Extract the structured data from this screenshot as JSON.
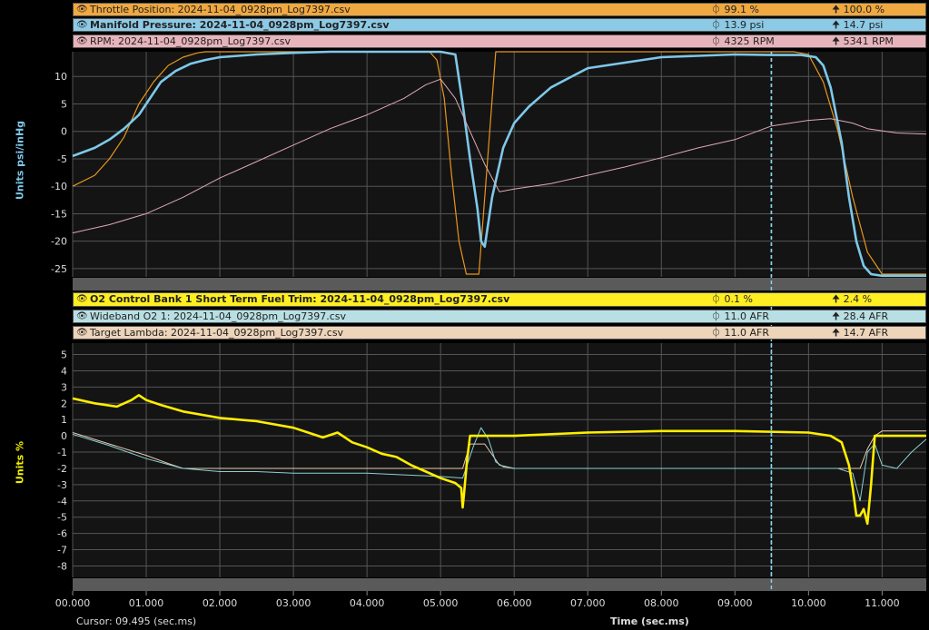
{
  "panels": [
    {
      "headers": [
        {
          "name": "Throttle Position: 2024-11-04_0928pm_Log7397.csv",
          "cursor": "99.1 %",
          "max": "100.0 %",
          "bg": "#f0a840",
          "bold": false
        },
        {
          "name": "Manifold Pressure: 2024-11-04_0928pm_Log7397.csv",
          "cursor": "13.9 psi",
          "max": "14.7 psi",
          "bg": "#8ccae6",
          "bold": true
        },
        {
          "name": "RPM: 2024-11-04_0928pm_Log7397.csv",
          "cursor": "4325 RPM",
          "max": "5341 RPM",
          "bg": "#e8b4bc",
          "bold": false
        }
      ],
      "axis_title": "Units psi/inHg",
      "axis_color": "#7ec8ea"
    },
    {
      "headers": [
        {
          "name": "O2 Control Bank 1 Short Term Fuel Trim: 2024-11-04_0928pm_Log7397.csv",
          "cursor": "0.1 %",
          "max": "2.4 %",
          "bg": "#ffee22",
          "bold": true
        },
        {
          "name": "Wideband O2 1: 2024-11-04_0928pm_Log7397.csv",
          "cursor": "11.0 AFR",
          "max": "28.4 AFR",
          "bg": "#b8e0e4",
          "bold": false
        },
        {
          "name": "Target Lambda: 2024-11-04_0928pm_Log7397.csv",
          "cursor": "11.0 AFR",
          "max": "14.7 AFR",
          "bg": "#eed4b8",
          "bold": false
        }
      ],
      "axis_title": "Units %",
      "axis_color": "#f0f000"
    }
  ],
  "cursor_label": "Cursor: 09.495 (sec.ms)",
  "time_label": "Time (sec.ms)",
  "icons": {
    "eye": "eye-icon",
    "cursor": "cursor-icon",
    "max": "max-arrow-icon"
  },
  "chart_data": [
    {
      "type": "line",
      "x_ticks": [
        "00.000",
        "01.000",
        "02.000",
        "03.000",
        "04.000",
        "05.000",
        "06.000",
        "07.000",
        "08.000",
        "09.000",
        "10.000",
        "11.000"
      ],
      "y_ticks": [
        10,
        5,
        0,
        -5,
        -10,
        -15,
        -20,
        -25
      ],
      "ylim": [
        -26.5,
        14.5
      ],
      "xlim": [
        0,
        11.6
      ],
      "cursor_x": 9.495,
      "series": [
        {
          "name": "Throttle Position",
          "color": "#e8961a",
          "width": 1.2,
          "x": [
            0,
            0.3,
            0.5,
            0.7,
            0.9,
            1.1,
            1.3,
            1.5,
            1.7,
            1.8,
            2.0,
            2.5,
            3.0,
            3.5,
            4.0,
            4.5,
            4.85,
            4.95,
            5.05,
            5.15,
            5.25,
            5.35,
            5.45,
            5.52,
            5.6,
            5.75,
            6.0,
            7.0,
            8.0,
            9.0,
            9.8,
            10.0,
            10.2,
            10.4,
            10.6,
            10.8,
            11.0,
            11.2,
            11.6
          ],
          "y": [
            -10,
            -8,
            -5,
            -1,
            5,
            9,
            12,
            13.5,
            14.3,
            14.5,
            14.5,
            14.5,
            14.5,
            14.5,
            14.5,
            14.5,
            14.5,
            13,
            6,
            -8,
            -20,
            -26,
            -26,
            -26,
            -12,
            14.5,
            14.5,
            14.5,
            14.5,
            14.5,
            14.5,
            14,
            9,
            0,
            -12,
            -22,
            -26,
            -26,
            -26
          ]
        },
        {
          "name": "Manifold Pressure",
          "color": "#7ec8ea",
          "width": 2.6,
          "x": [
            0,
            0.3,
            0.5,
            0.7,
            0.9,
            1.05,
            1.2,
            1.4,
            1.6,
            1.8,
            2.0,
            2.5,
            3.0,
            3.5,
            4.0,
            4.5,
            5.0,
            5.2,
            5.3,
            5.4,
            5.5,
            5.55,
            5.6,
            5.7,
            5.85,
            6.0,
            6.2,
            6.5,
            7.0,
            8.0,
            9.0,
            9.5,
            9.9,
            10.1,
            10.2,
            10.3,
            10.45,
            10.55,
            10.65,
            10.75,
            10.85,
            11.0,
            11.2,
            11.6
          ],
          "y": [
            -4.5,
            -3,
            -1.5,
            0.5,
            3,
            6,
            9,
            11,
            12.3,
            13,
            13.5,
            14,
            14.3,
            14.5,
            14.5,
            14.5,
            14.5,
            14,
            5,
            -5,
            -14,
            -20,
            -21,
            -12,
            -3,
            1.5,
            4.5,
            8,
            11.5,
            13.5,
            14,
            13.9,
            13.9,
            13.5,
            12,
            8,
            -2,
            -12,
            -20,
            -24.5,
            -26,
            -26.3,
            -26.3,
            -26.3
          ]
        },
        {
          "name": "RPM",
          "color": "#e0a8b4",
          "width": 1.0,
          "x": [
            0,
            0.5,
            1.0,
            1.5,
            2.0,
            2.5,
            3.0,
            3.5,
            4.0,
            4.5,
            4.8,
            5.0,
            5.2,
            5.4,
            5.6,
            5.8,
            6.0,
            6.5,
            7.0,
            7.5,
            8.0,
            8.5,
            9.0,
            9.5,
            10.0,
            10.3,
            10.6,
            10.8,
            11.2,
            11.6
          ],
          "y": [
            -18.5,
            -17,
            -15,
            -12,
            -8.5,
            -5.5,
            -2.5,
            0.5,
            3,
            6,
            8.5,
            9.5,
            6,
            0,
            -6,
            -11,
            -10.5,
            -9.5,
            -8,
            -6.5,
            -4.8,
            -3,
            -1.5,
            1,
            2,
            2.3,
            1.5,
            0.5,
            -0.3,
            -0.5
          ]
        }
      ]
    },
    {
      "type": "line",
      "x_ticks": [
        "00.000",
        "01.000",
        "02.000",
        "03.000",
        "04.000",
        "05.000",
        "06.000",
        "07.000",
        "08.000",
        "09.000",
        "10.000",
        "11.000"
      ],
      "y_ticks": [
        5,
        4,
        3,
        2,
        1,
        0,
        -1,
        -2,
        -3,
        -4,
        -5,
        -6,
        -7,
        -8
      ],
      "ylim": [
        -8.7,
        5.7
      ],
      "xlim": [
        0,
        11.6
      ],
      "cursor_x": 9.495,
      "series": [
        {
          "name": "Target Lambda",
          "color": "#e8cbb0",
          "width": 1.0,
          "x": [
            0,
            0.5,
            1.0,
            1.3,
            1.5,
            2.0,
            3.0,
            4.0,
            5.0,
            5.3,
            5.4,
            5.6,
            5.8,
            6.0,
            7.0,
            8.0,
            9.0,
            10.0,
            10.5,
            10.7,
            10.8,
            10.9,
            11.0,
            11.6
          ],
          "y": [
            0.2,
            -0.5,
            -1.2,
            -1.7,
            -2.0,
            -2.0,
            -2.0,
            -2.0,
            -2.0,
            -2.0,
            -0.5,
            -0.5,
            -1.8,
            -2.0,
            -2.0,
            -2.0,
            -2.0,
            -2.0,
            -2.0,
            -2.0,
            -0.8,
            0,
            0.3,
            0.3
          ]
        },
        {
          "name": "Wideband O2 1",
          "color": "#8ad0d4",
          "width": 1.0,
          "x": [
            0,
            0.5,
            1.0,
            1.5,
            2.0,
            2.5,
            3.0,
            3.5,
            4.0,
            4.5,
            5.0,
            5.3,
            5.45,
            5.55,
            5.65,
            5.75,
            5.85,
            6.0,
            6.5,
            7.0,
            7.5,
            8.0,
            8.5,
            9.0,
            9.5,
            10.0,
            10.4,
            10.6,
            10.7,
            10.8,
            10.9,
            11.0,
            11.2,
            11.4,
            11.6
          ],
          "y": [
            0.1,
            -0.6,
            -1.4,
            -2.0,
            -2.2,
            -2.2,
            -2.3,
            -2.3,
            -2.3,
            -2.4,
            -2.5,
            -2.6,
            -0.6,
            0.5,
            -0.2,
            -1.6,
            -1.9,
            -2.0,
            -2.0,
            -2.0,
            -2.0,
            -2.0,
            -2.0,
            -2.0,
            -2.0,
            -2.0,
            -2.0,
            -2.3,
            -4.0,
            -1.0,
            -0.5,
            -1.8,
            -2.0,
            -1.0,
            -0.2
          ]
        },
        {
          "name": "O2 Control Bank 1 Short Term Fuel Trim",
          "color": "#ffee00",
          "width": 2.6,
          "x": [
            0,
            0.3,
            0.6,
            0.8,
            0.9,
            1.0,
            1.2,
            1.5,
            2.0,
            2.5,
            3.0,
            3.2,
            3.4,
            3.6,
            3.8,
            4.0,
            4.2,
            4.4,
            4.6,
            4.8,
            5.0,
            5.2,
            5.28,
            5.3,
            5.32,
            5.36,
            5.4,
            6.0,
            7.0,
            8.0,
            9.0,
            10.0,
            10.3,
            10.45,
            10.55,
            10.6,
            10.65,
            10.7,
            10.75,
            10.8,
            10.85,
            10.9,
            11.0,
            11.6
          ],
          "y": [
            2.3,
            2.0,
            1.8,
            2.2,
            2.5,
            2.2,
            1.9,
            1.5,
            1.1,
            0.9,
            0.5,
            0.2,
            -0.1,
            0.2,
            -0.4,
            -0.7,
            -1.1,
            -1.3,
            -1.8,
            -2.2,
            -2.6,
            -2.9,
            -3.2,
            -4.4,
            -3.5,
            -1.5,
            0,
            0,
            0.2,
            0.3,
            0.3,
            0.2,
            0,
            -0.4,
            -1.8,
            -3.2,
            -4.9,
            -4.9,
            -4.5,
            -5.4,
            -3.0,
            0,
            0,
            0
          ]
        }
      ]
    }
  ]
}
